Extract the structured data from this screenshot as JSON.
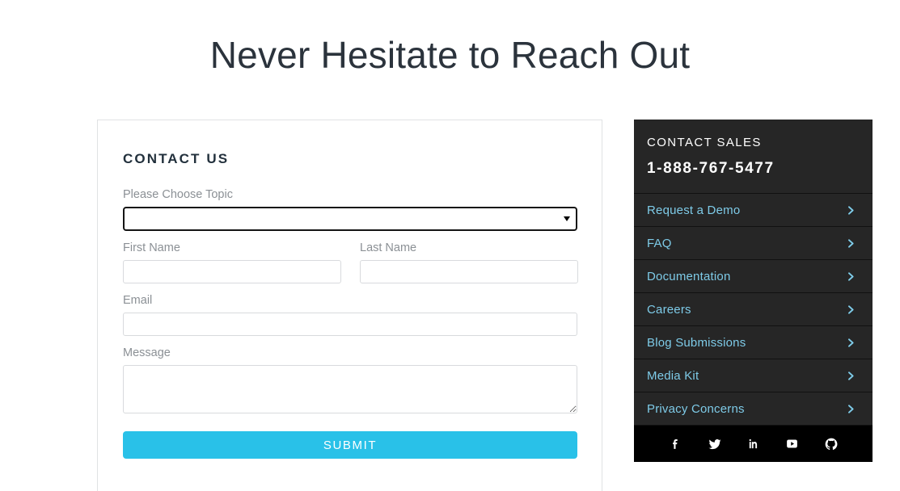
{
  "page": {
    "title": "Never Hesitate to Reach Out"
  },
  "form": {
    "heading": "CONTACT US",
    "topic": {
      "label": "Please Choose Topic",
      "selected": "",
      "options": [
        ""
      ]
    },
    "first_name": {
      "label": "First Name",
      "value": "",
      "placeholder": ""
    },
    "last_name": {
      "label": "Last Name",
      "value": "",
      "placeholder": ""
    },
    "email": {
      "label": "Email",
      "value": "",
      "placeholder": ""
    },
    "message": {
      "label": "Message",
      "value": "",
      "placeholder": ""
    },
    "submit_label": "SUBMIT"
  },
  "sidebar": {
    "sales_label": "CONTACT SALES",
    "phone": "1-888-767-5477",
    "menu": [
      {
        "label": "Request a Demo",
        "icon": "chevron-right-icon"
      },
      {
        "label": "FAQ",
        "icon": "chevron-right-icon"
      },
      {
        "label": "Documentation",
        "icon": "chevron-right-icon"
      },
      {
        "label": "Careers",
        "icon": "chevron-right-icon"
      },
      {
        "label": "Blog Submissions",
        "icon": "chevron-right-icon"
      },
      {
        "label": "Media Kit",
        "icon": "chevron-right-icon"
      },
      {
        "label": "Privacy Concerns",
        "icon": "chevron-right-icon"
      }
    ],
    "social": [
      {
        "name": "facebook-icon",
        "title": "Facebook"
      },
      {
        "name": "twitter-icon",
        "title": "Twitter"
      },
      {
        "name": "linkedin-icon",
        "title": "LinkedIn"
      },
      {
        "name": "youtube-icon",
        "title": "YouTube"
      },
      {
        "name": "github-icon",
        "title": "GitHub"
      }
    ]
  },
  "colors": {
    "title_text": "#2b333c",
    "accent_button": "#29c1e8",
    "link_blue": "#7ecbe8",
    "sidebar_bg": "#262626",
    "social_bg": "#000000",
    "label_gray": "#8b9095"
  }
}
